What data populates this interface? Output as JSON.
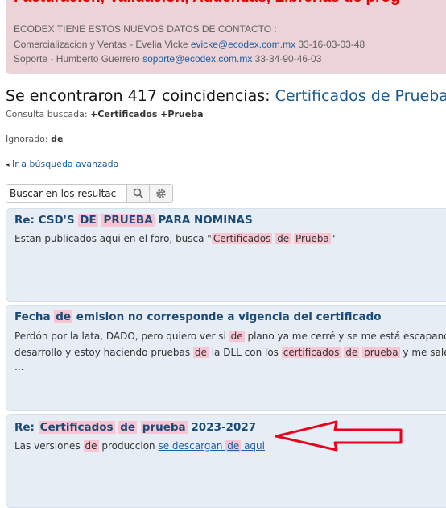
{
  "notice": {
    "title": "Facturacion, Validacion, Addendas, Librerias de prog",
    "line1": "ECODEX TIENE ESTOS NUEVOS DATOS DE CONTACTO :",
    "line2_prefix": "Comercializacion y Ventas - Evelia Vicke ",
    "line2_email": "evicke@ecodex.com.mx",
    "line2_phone": " 33-16-03-03-48",
    "line3_prefix": "Soporte - Humberto Guerrero ",
    "line3_email": "soporte@ecodex.com.mx",
    "line3_phone": " 33-34-90-46-03"
  },
  "results_heading": {
    "prefix": "Se encontraron 417 coincidencias: ",
    "term": "Certificados de Prueba"
  },
  "query": {
    "label": "Consulta buscada: ",
    "value": "+Certificados +Prueba"
  },
  "ignored": {
    "label": "Ignorado: ",
    "value": "de"
  },
  "advanced_link": "Ir a búsqueda avanzada",
  "search": {
    "value": "Buscar en los resultac"
  },
  "icons": {
    "search": "search-icon",
    "settings": "gear-icon",
    "back": "chevron-left-icon",
    "annotation": "red-arrow-annotation"
  },
  "colors": {
    "highlight": "#f7c6d2",
    "accent": "#1d5a8e",
    "notice_bg": "#ecd3d7",
    "result_bg": "#e6edf4",
    "arrow": "#e8001c"
  },
  "results": [
    {
      "title_prefix": "Re: CSD'S ",
      "title_hl1": "DE",
      "title_hl2": "PRUEBA",
      "title_suffix": " PARA NOMINAS",
      "body_prefix": "Estan publicados aqui en el foro, busca \"",
      "body_hl1": "Certificados",
      "body_hl2": "de",
      "body_hl3": "Prueba",
      "body_suffix": "\""
    },
    {
      "title_prefix": "Fecha ",
      "title_hl1": "de",
      "title_suffix": " emision no corresponde a vigencia del certificado",
      "l1_prefix": "Perdón por la lata, DADO, pero quiero ver si ",
      "l1_hl": "de",
      "l1_suffix": " plano ya me cerré y se me está escapando u",
      "l2_prefix": "desarrollo y estoy haciendo pruebas ",
      "l2_hl1": "de",
      "l2_mid": " la DLL con los ",
      "l2_hl2": "certificados",
      "l2_hl3": "de",
      "l2_hl4": "prueba",
      "l2_suffix": " y me sale el",
      "l3": "..."
    },
    {
      "title_prefix": "Re: ",
      "title_hl1": "Certificados",
      "title_hl2": "de",
      "title_hl3": "prueba",
      "title_suffix": " 2023-2027",
      "body_prefix": "Las versiones ",
      "body_hl1": "de",
      "body_mid": " produccion ",
      "body_link1": "se descargan ",
      "body_hl2": "de",
      "body_link2": " aqui"
    }
  ]
}
